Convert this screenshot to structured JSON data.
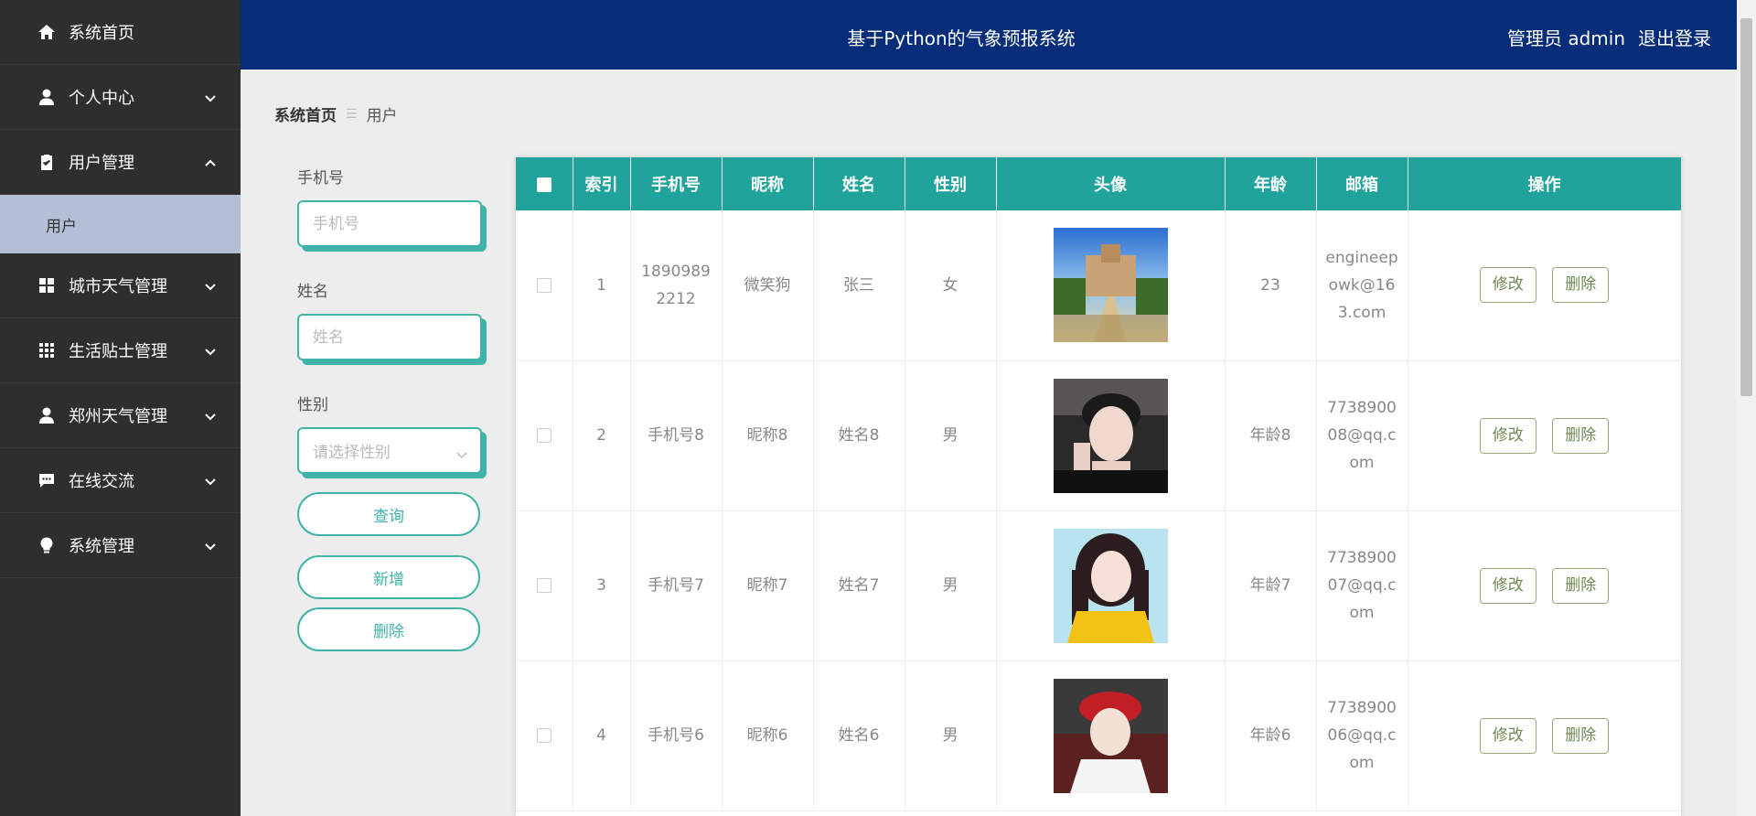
{
  "header": {
    "title": "基于Python的气象预报系统",
    "role_label": "管理员 admin",
    "logout_label": "退出登录"
  },
  "sidebar": {
    "items": [
      {
        "label": "系统首页",
        "icon": "home-icon"
      },
      {
        "label": "个人中心",
        "icon": "person-icon"
      },
      {
        "label": "用户管理",
        "icon": "clipboard-icon"
      },
      {
        "label": "城市天气管理",
        "icon": "grid-icon"
      },
      {
        "label": "生活贴士管理",
        "icon": "apps-icon"
      },
      {
        "label": "郑州天气管理",
        "icon": "person-icon"
      },
      {
        "label": "在线交流",
        "icon": "chat-icon"
      },
      {
        "label": "系统管理",
        "icon": "bulb-icon"
      }
    ],
    "submenu": {
      "label": "用户"
    }
  },
  "breadcrumb": {
    "home": "系统首页",
    "current": "用户"
  },
  "search": {
    "phone_label": "手机号",
    "phone_placeholder": "手机号",
    "name_label": "姓名",
    "name_placeholder": "姓名",
    "gender_label": "性别",
    "gender_placeholder": "请选择性别",
    "query_button": "查询",
    "add_button": "新增",
    "delete_button": "删除"
  },
  "table": {
    "columns": [
      "索引",
      "手机号",
      "昵称",
      "姓名",
      "性别",
      "头像",
      "年龄",
      "邮箱",
      "操作"
    ],
    "edit_label": "修改",
    "delete_label": "删除",
    "rows": [
      {
        "index": "1",
        "phone": "18909892212",
        "nickname": "微笑狗",
        "name": "张三",
        "gender": "女",
        "age": "23",
        "email": "engineepowk@163.com",
        "avatar": "building-photo"
      },
      {
        "index": "2",
        "phone": "手机号8",
        "nickname": "昵称8",
        "name": "姓名8",
        "gender": "男",
        "age": "年龄8",
        "email": "773890008@qq.com",
        "avatar": "portrait-photo"
      },
      {
        "index": "3",
        "phone": "手机号7",
        "nickname": "昵称7",
        "name": "姓名7",
        "gender": "男",
        "age": "年龄7",
        "email": "773890007@qq.com",
        "avatar": "portrait-photo"
      },
      {
        "index": "4",
        "phone": "手机号6",
        "nickname": "昵称6",
        "name": "姓名6",
        "gender": "男",
        "age": "年龄6",
        "email": "773890006@qq.com",
        "avatar": "portrait-photo"
      }
    ]
  },
  "colors": {
    "sidebar_bg": "#2e2e2e",
    "header_bg": "#062d7a",
    "accent": "#20a39a",
    "submenu_bg": "#b4bfd6"
  }
}
